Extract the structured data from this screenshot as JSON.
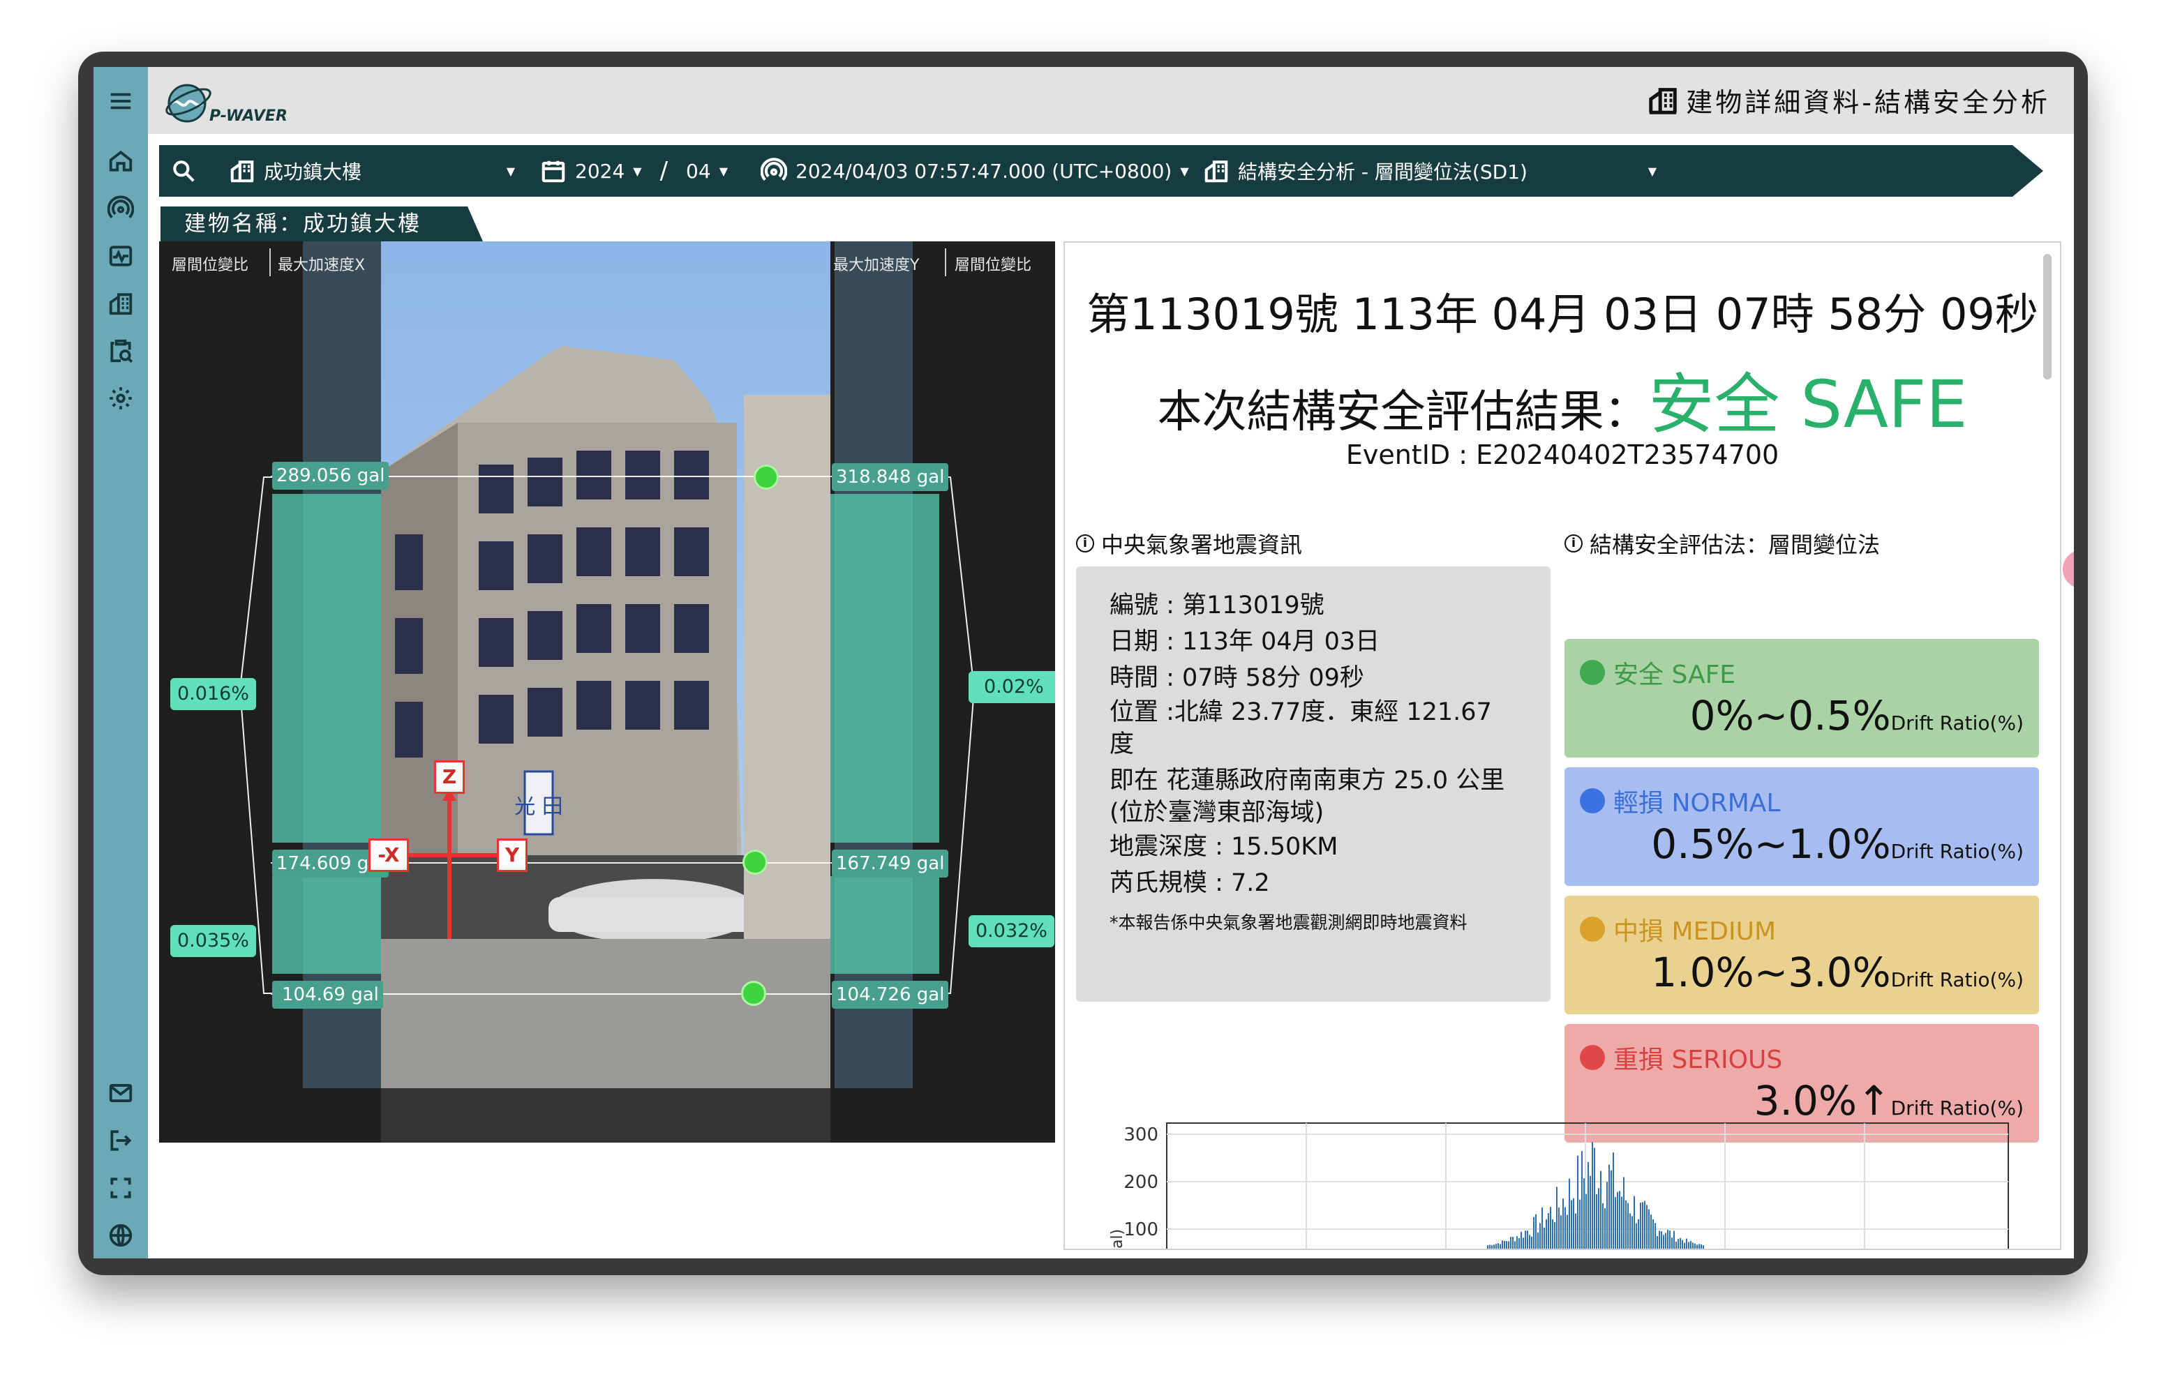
{
  "app": {
    "logo_text": "P-WAVER",
    "page_title": "建物詳細資料-結構安全分析"
  },
  "filters": {
    "building": "成功鎮大樓",
    "year": "2024",
    "separator": "/",
    "month": "04",
    "event_time": "2024/04/03 07:57:47.000 (UTC+0800)",
    "method": "結構安全分析 - 層間變位法(SD1)"
  },
  "building_name_label": "建物名稱：成功鎮大樓",
  "left_panel": {
    "headers": {
      "drift_left": "層間位變比",
      "acc_x": "最大加速度X",
      "acc_y": "最大加速度Y",
      "drift_right": "層間位變比"
    },
    "acc_x_labels": [
      "289.056 gal",
      "174.609 gal",
      "104.69 gal"
    ],
    "acc_y_labels": [
      "318.848 gal",
      "167.749 gal",
      "104.726 gal"
    ],
    "drift_left": [
      "0.016%",
      "0.035%"
    ],
    "drift_right": [
      "0.02%",
      "0.032%"
    ],
    "axes": {
      "z": "Z",
      "x": "-X",
      "y": "Y"
    },
    "building_sign": "光 田"
  },
  "report": {
    "event_line": "第113019號 113年 04月 03日 07時 58分 09秒",
    "result_prefix": "本次結構安全評估結果：",
    "result_value": "安全 SAFE",
    "event_id": "EventID : E20240402T23574700",
    "quake_title": "中央氣象署地震資訊",
    "quake_lines": [
      "編號 : 第113019號",
      "日期 : 113年 04月 03日",
      "時間 : 07時 58分 09秒",
      "位置 :北緯 23.77度．東經 121.67 度",
      "即在 花蓮縣政府南南東方 25.0 公里 (位於臺灣東部海域)",
      "地震深度 : 15.50KM",
      "芮氏規模 : 7.2"
    ],
    "quake_note": "*本報告係中央氣象署地震觀測網即時地震資料",
    "method_title": "結構安全評估法：層間變位法",
    "levels": [
      {
        "name": "安全 SAFE",
        "range": "0%~0.5%",
        "unit": "Drift Ratio(%)",
        "bg": "#a9d3a5",
        "dot": "#3faa4f",
        "text": "#3f9a48"
      },
      {
        "name": "輕損 NORMAL",
        "range": "0.5%~1.0%",
        "unit": "Drift Ratio(%)",
        "bg": "#a7bdf1",
        "dot": "#3b72e2",
        "text": "#3b6fd6"
      },
      {
        "name": "中損 MEDIUM",
        "range": "1.0%~3.0%",
        "unit": "Drift Ratio(%)",
        "bg": "#ebd18f",
        "dot": "#d9a12a",
        "text": "#c99420"
      },
      {
        "name": "重損 SERIOUS",
        "range": "3.0%↑",
        "unit": "Drift Ratio(%)",
        "bg": "#eeaaa8",
        "dot": "#e04848",
        "text": "#d84040"
      }
    ]
  },
  "chart_data": {
    "type": "bar",
    "yticks": [
      300,
      200,
      100
    ],
    "ylabel": "al)",
    "color": "#2e6fb4"
  }
}
